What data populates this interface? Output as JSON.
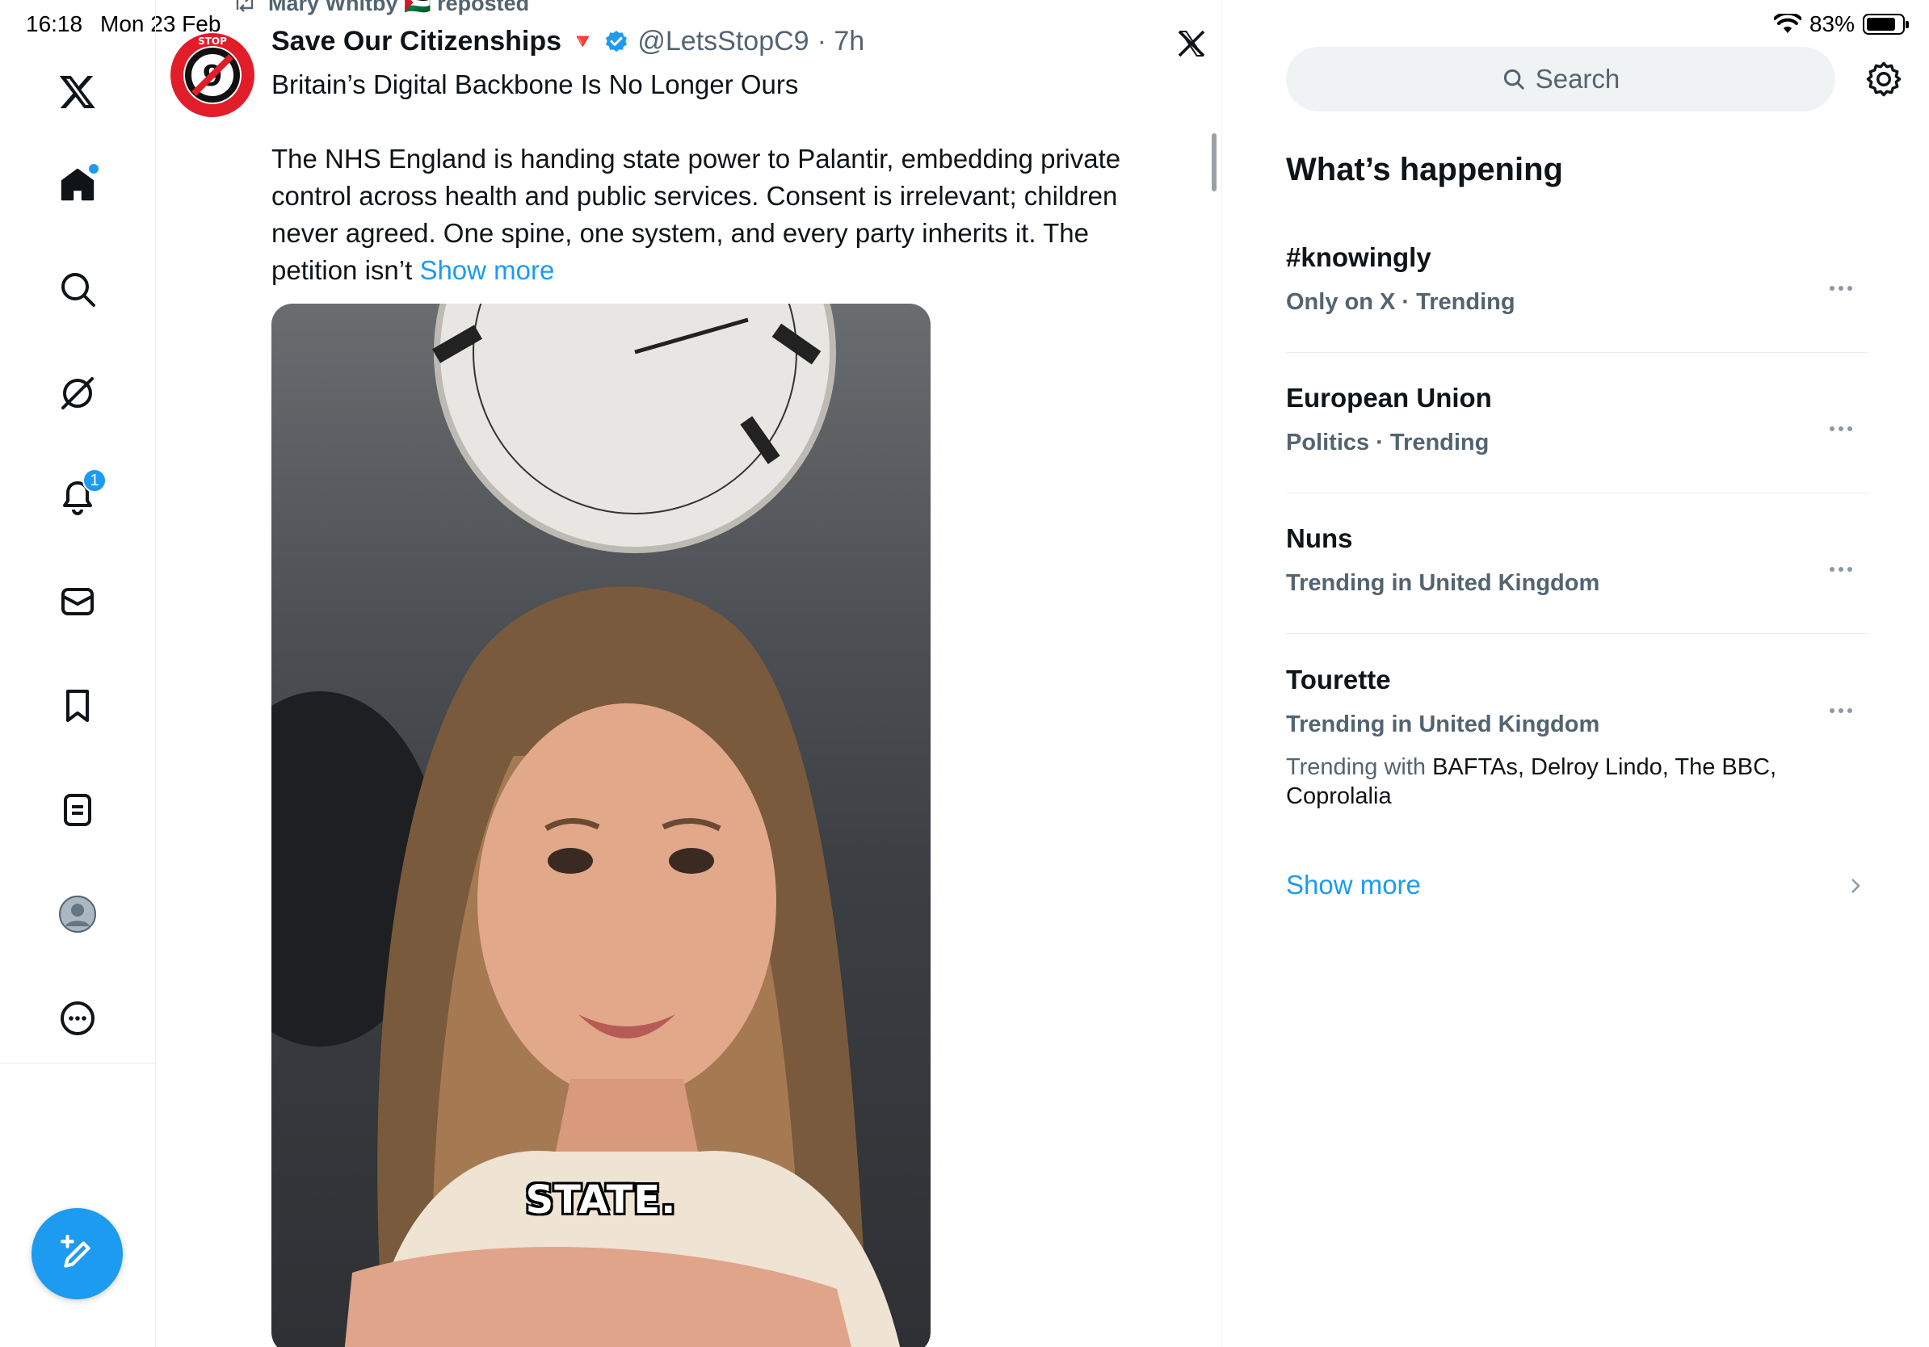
{
  "status_bar": {
    "time": "16:18",
    "date": "Mon 23 Feb",
    "battery": "83%",
    "battery_level": 0.83
  },
  "nav": {
    "notifications_count": "1",
    "items": [
      "x-logo-icon",
      "home-icon",
      "search-icon",
      "grok-icon",
      "bell-icon",
      "mail-icon",
      "bookmark-icon",
      "lists-icon",
      "profile-icon",
      "more-icon"
    ]
  },
  "tweet": {
    "repost_label": "Mary Whitby 🇵🇸 reposted",
    "author_name": "Save Our Citizenships",
    "author_emoji": "🔻",
    "handle": "@LetsStopC9",
    "time": "· 7h",
    "headline": "Britain’s Digital Backbone Is No Longer Ours",
    "body": "The NHS England is handing state power to Palantir, embedding private control across health and public services. Consent is irrelevant; children never agreed. One spine, one system, and every party inherits it. The petition isn’t",
    "show_more": "Show more",
    "video_caption": "STATE."
  },
  "sidebar": {
    "search_placeholder": "Search",
    "title": "What’s happening",
    "trends": [
      {
        "title": "#knowingly",
        "meta": "Only on X · Trending"
      },
      {
        "title": "European Union",
        "meta": "Politics · Trending"
      },
      {
        "title": "Nuns",
        "meta": "Trending in United Kingdom"
      },
      {
        "title": "Tourette",
        "meta": "Trending in United Kingdom",
        "with_prefix": "Trending with",
        "with_list": "BAFTAs, Delroy Lindo, The BBC, Coprolalia"
      }
    ],
    "show_more": "Show more"
  },
  "colors": {
    "accent": "#1d9bf0",
    "text_primary": "#0f1419",
    "text_secondary": "#536471",
    "divider": "#e6ecf0"
  }
}
